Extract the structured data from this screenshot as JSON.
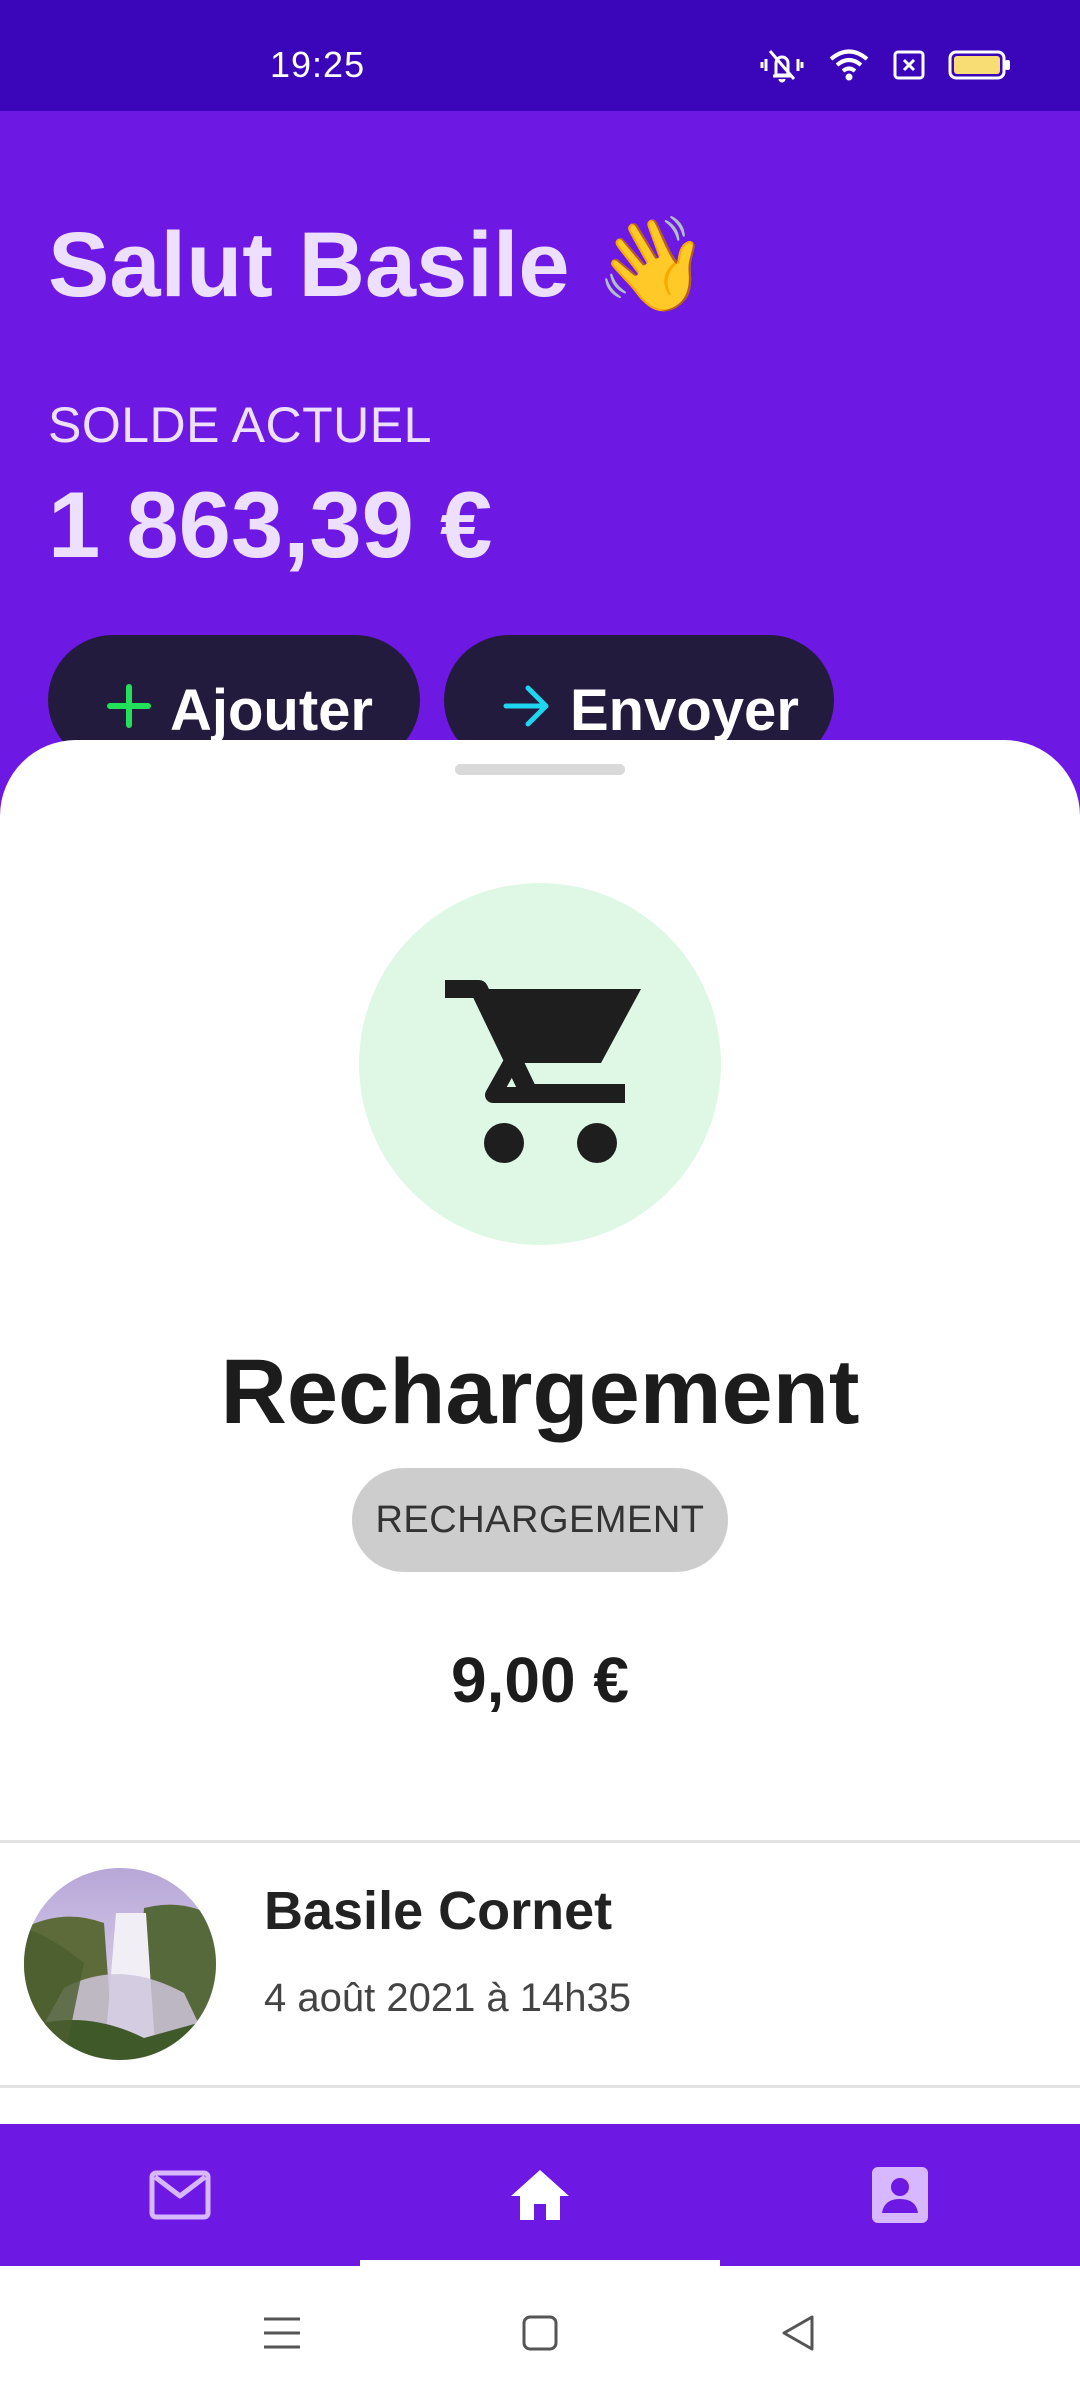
{
  "status_bar": {
    "time": "19:25"
  },
  "header": {
    "greeting": "Salut Basile",
    "greeting_emoji": "👋",
    "balance_label": "SOLDE ACTUEL",
    "balance_value": "1 863,39 €",
    "buttons": {
      "add_label": "Ajouter",
      "send_label": "Envoyer"
    }
  },
  "transaction": {
    "icon": "shopping-cart-icon",
    "title": "Rechargement",
    "category": "RECHARGEMENT",
    "amount": "9,00 €",
    "person_name": "Basile Cornet",
    "date": "4 août 2021 à 14h35"
  },
  "bottom_nav": {
    "items": [
      {
        "icon": "mail-icon"
      },
      {
        "icon": "home-icon",
        "active": true
      },
      {
        "icon": "profile-icon"
      }
    ]
  },
  "colors": {
    "primary": "#6e18e4",
    "status_bar": "#3b05ba",
    "button_bg": "#231b3d",
    "add_accent": "#22e05a",
    "send_accent": "#1fd6f0",
    "icon_circle": "#dff7e5"
  }
}
